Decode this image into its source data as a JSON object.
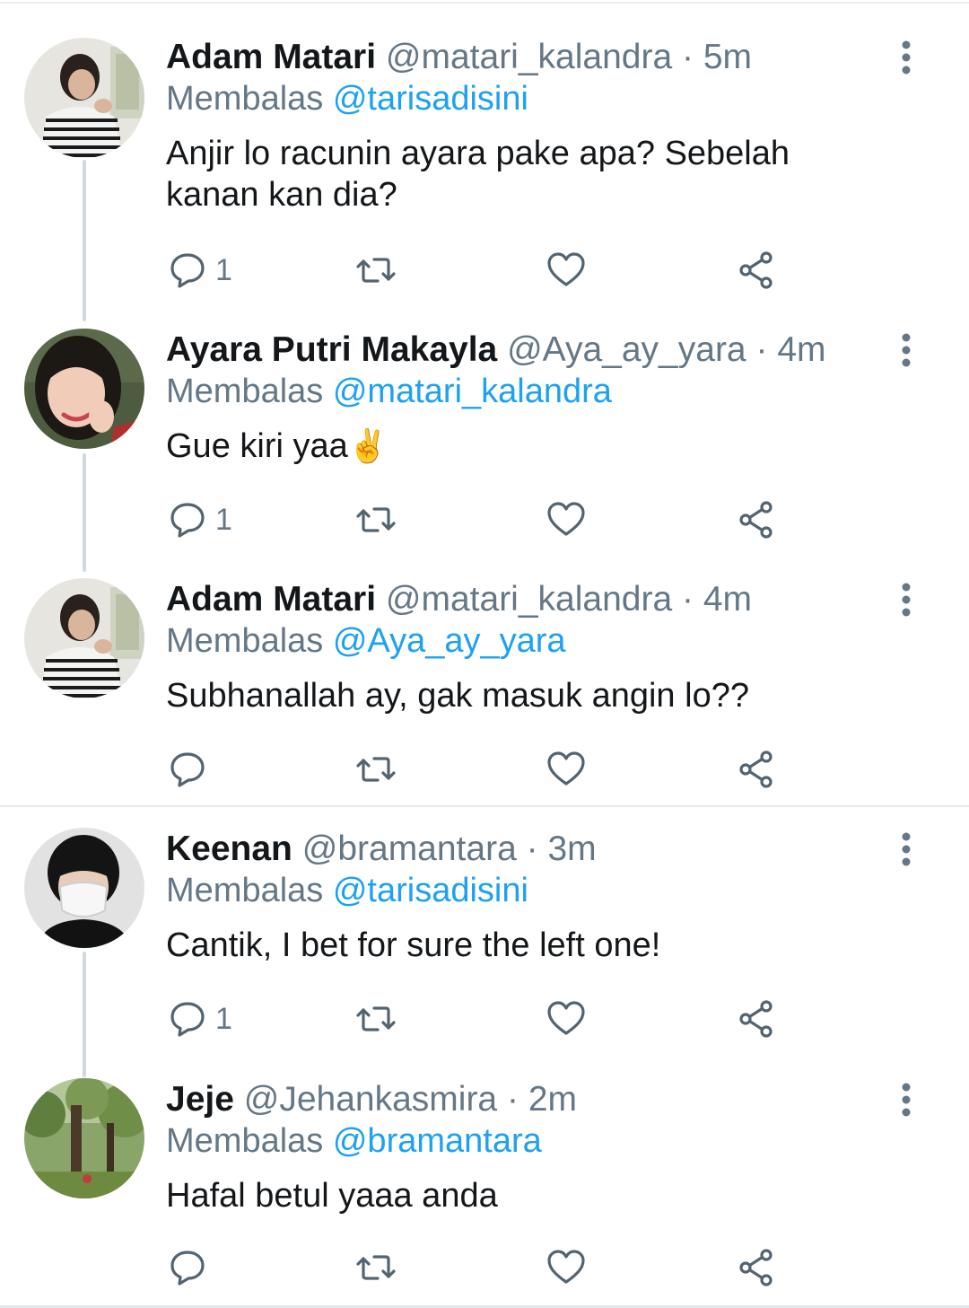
{
  "tweets": [
    {
      "name": "Adam Matari",
      "handle": "@matari_kalandra",
      "time": "5m",
      "reply_prefix": "Membalas",
      "reply_to": "@tarisadisini",
      "text": "Anjir lo racunin ayara pake apa? Sebelah kanan kan dia?",
      "reply_count": "1",
      "avatar": "striped-shirt-avatar"
    },
    {
      "name": "Ayara Putri Makayla",
      "handle": "@Aya_ay_yara",
      "time": "4m",
      "reply_prefix": "Membalas",
      "reply_to": "@matari_kalandra",
      "text": "Gue kiri yaa",
      "emoji": "✌️",
      "reply_count": "1",
      "avatar": "smiling-girl-avatar"
    },
    {
      "name": "Adam Matari",
      "handle": "@matari_kalandra",
      "time": "4m",
      "reply_prefix": "Membalas",
      "reply_to": "@Aya_ay_yara",
      "text": "Subhanallah ay, gak masuk angin lo??",
      "reply_count": "",
      "avatar": "striped-shirt-avatar"
    },
    {
      "name": "Keenan",
      "handle": "@bramantara",
      "time": "3m",
      "reply_prefix": "Membalas",
      "reply_to": "@tarisadisini",
      "text": "Cantik, I bet for sure the left one!",
      "reply_count": "1",
      "avatar": "masked-man-avatar"
    },
    {
      "name": "Jeje",
      "handle": "@Jehankasmira",
      "time": "2m",
      "reply_prefix": "Membalas",
      "reply_to": "@bramantara",
      "text": "Hafal betul yaaa anda",
      "reply_count": "",
      "avatar": "forest-avatar"
    }
  ],
  "icons": [
    "reply-icon",
    "retweet-icon",
    "like-icon",
    "share-icon",
    "more-icon"
  ],
  "colors": {
    "mention": "#1da1f2",
    "secondary": "#657786",
    "primary_text": "#14171a",
    "thread_line": "#cfd9de"
  }
}
